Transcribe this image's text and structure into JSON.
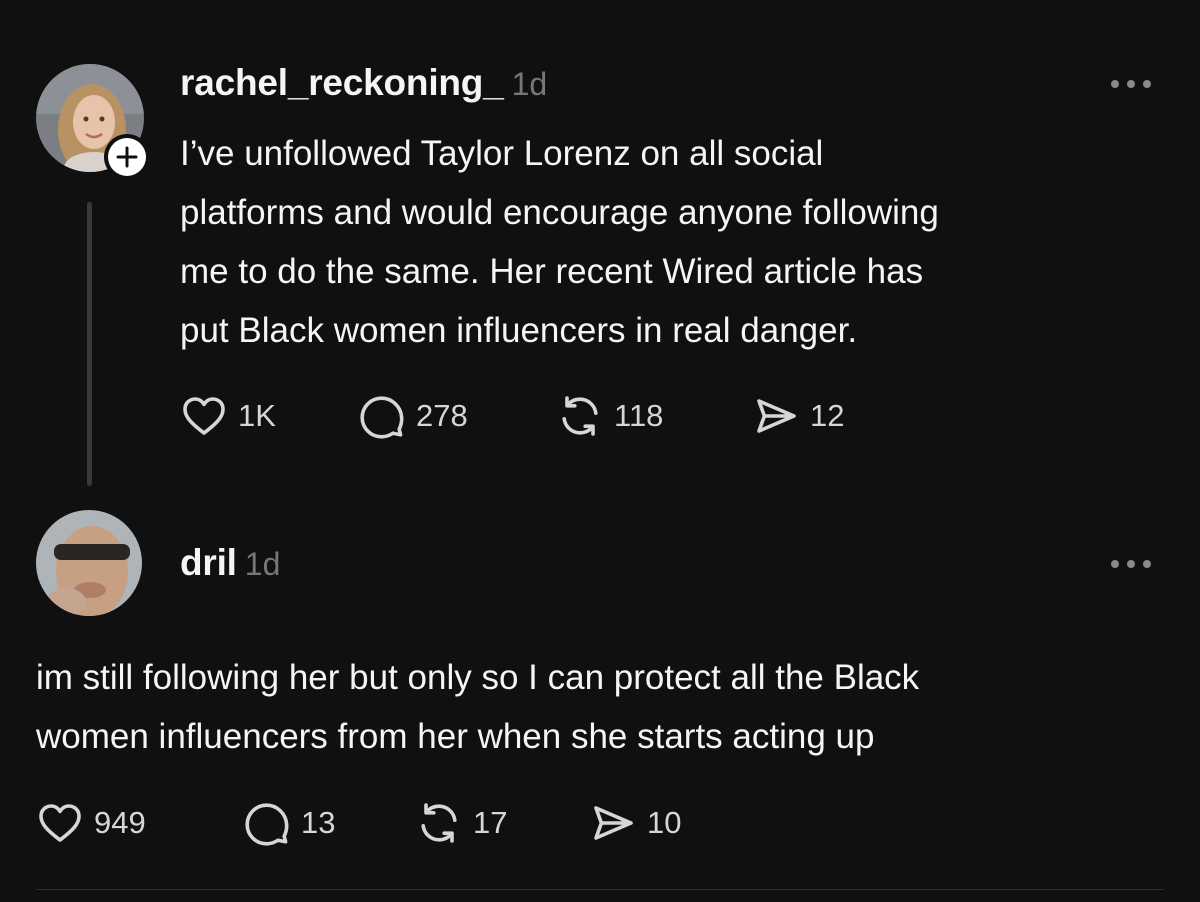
{
  "colors": {
    "background": "#101010",
    "text": "#f3f5f7",
    "muted": "#777777",
    "icon": "#d6d6d6",
    "thread_line": "#3a3a3a"
  },
  "post1": {
    "username": "rachel_reckoning_",
    "time": "1d",
    "avatar_icon": "avatar-photo",
    "follow_icon": "plus-icon",
    "more_icon": "more-horizontal-icon",
    "text": "I’ve unfollowed Taylor Lorenz on all social\nplatforms and would encourage anyone following\nme to do the same. Her recent Wired article has\nput Black women influencers in real danger.",
    "likes": "1K",
    "comments": "278",
    "reposts": "118",
    "shares": "12"
  },
  "post2": {
    "username": "dril",
    "time": "1d",
    "avatar_icon": "avatar-photo",
    "more_icon": "more-horizontal-icon",
    "text": "im still following  her but only so I can protect all the Black\nwomen influencers from her when she starts acting up",
    "likes": "949",
    "comments": "13",
    "reposts": "17",
    "shares": "10"
  }
}
